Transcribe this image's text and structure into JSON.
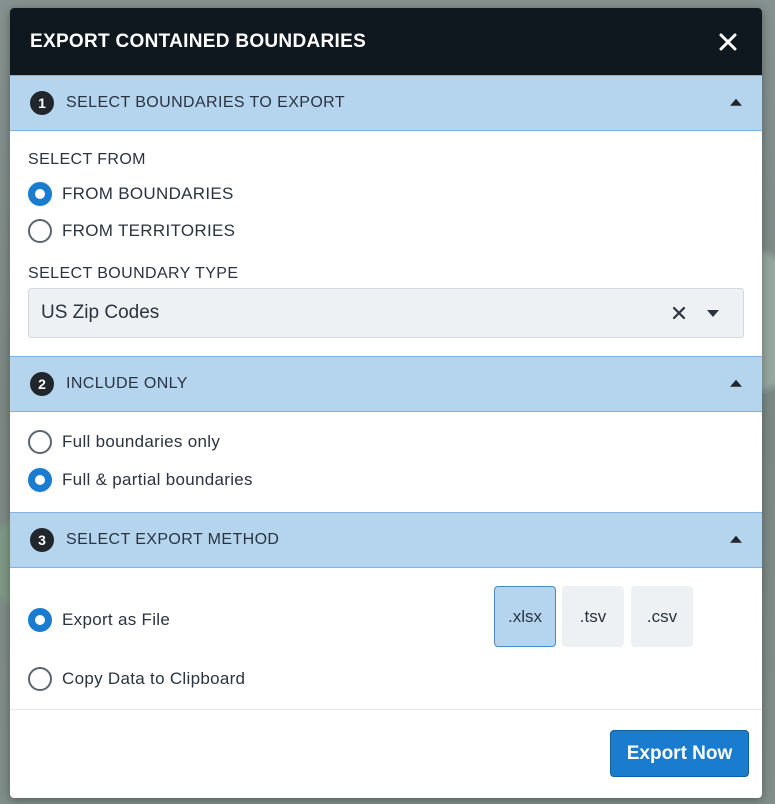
{
  "modal": {
    "title": "EXPORT CONTAINED BOUNDARIES"
  },
  "section1": {
    "step": "1",
    "title": "SELECT BOUNDARIES TO EXPORT",
    "select_from_label": "SELECT FROM",
    "options": [
      {
        "label": "FROM BOUNDARIES",
        "checked": true
      },
      {
        "label": "FROM TERRITORIES",
        "checked": false
      }
    ],
    "boundary_type_label": "SELECT BOUNDARY TYPE",
    "boundary_type_value": "US Zip Codes"
  },
  "section2": {
    "step": "2",
    "title": "INCLUDE ONLY",
    "options": [
      {
        "label": "Full boundaries only",
        "checked": false
      },
      {
        "label": "Full & partial boundaries",
        "checked": true
      }
    ]
  },
  "section3": {
    "step": "3",
    "title": "SELECT EXPORT METHOD",
    "options": [
      {
        "label": "Export as File",
        "checked": true
      },
      {
        "label": "Copy Data to Clipboard",
        "checked": false
      }
    ],
    "formats": [
      {
        "label": ".xlsx",
        "active": true
      },
      {
        "label": ".tsv",
        "active": false
      },
      {
        "label": ".csv",
        "active": false
      }
    ]
  },
  "footer": {
    "export_label": "Export Now"
  },
  "icons": {
    "close": "close-icon",
    "collapse": "chevron-up-icon",
    "clear": "clear-x-icon",
    "dropdown": "chevron-down-icon"
  },
  "colors": {
    "header_bg": "#10181f",
    "section_bg": "#b5d5ef",
    "accent": "#1a7ccf"
  }
}
